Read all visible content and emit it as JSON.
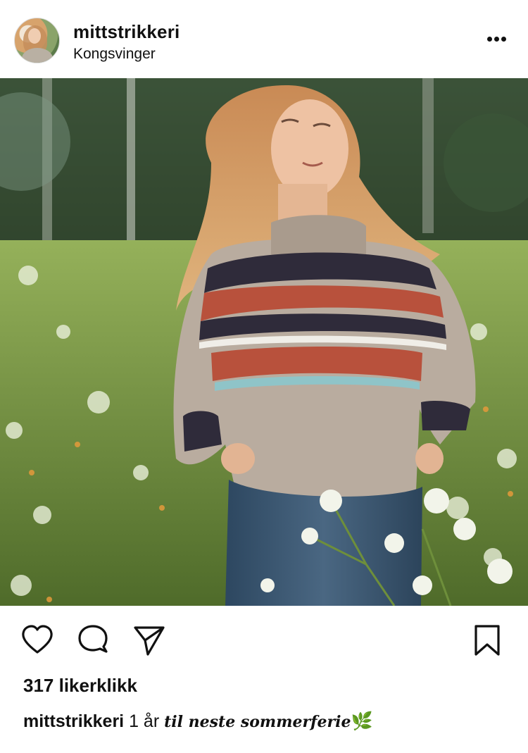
{
  "post": {
    "username": "mittstrikkeri",
    "location": "Kongsvinger",
    "more_icon": "ellipsis-icon",
    "likes_text": "317 likerklikk",
    "caption": {
      "username": "mittstrikkeri",
      "plain": "1 år",
      "styled": "til neste sommerferie",
      "emoji": "🌿"
    },
    "actions": {
      "like_icon": "heart-icon",
      "comment_icon": "comment-icon",
      "share_icon": "send-icon",
      "save_icon": "bookmark-icon"
    }
  },
  "colors": {
    "background": "#ffffff",
    "text": "#111111",
    "sweater": "#b9ac9f",
    "sweater_pattern_dark": "#2f2b3a",
    "sweater_pattern_red": "#b8513c",
    "sweater_pattern_blue": "#8fc4c8",
    "hair": "#d19a62",
    "jeans": "#3b5670",
    "meadow": "#7f9c4a"
  }
}
